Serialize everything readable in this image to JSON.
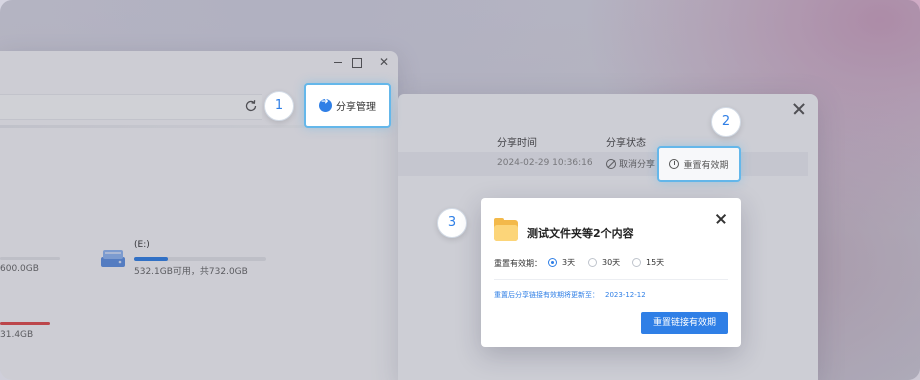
{
  "back_window": {
    "drive_left_size": "600.0GB",
    "drive_e_name": "(E:)",
    "drive_e_size": "532.1GB可用，共732.0GB",
    "drive_e_usage": 0.26,
    "drive_third_size": "31.4GB"
  },
  "share_window": {
    "col_time": "分享时间",
    "col_status": "分享状态",
    "row_time": "2024-02-29 10:36:16",
    "row_cancel": "取消分享"
  },
  "highlights": {
    "share_manage_label": "分享管理",
    "reset_label": "重置有效期"
  },
  "steps": [
    "1",
    "2",
    "3"
  ],
  "dialog": {
    "title": "测试文件夹等2个内容",
    "label": "重置有效期：",
    "options": [
      "3天",
      "30天",
      "15天"
    ],
    "selected": "3天",
    "note": "重置后分享链接有效期将更新至：",
    "note_date": "2023-12-12",
    "confirm": "重置链接有效期"
  },
  "colors": {
    "accent": "#2f7fe6",
    "highlight_border": "#64b7ea"
  }
}
